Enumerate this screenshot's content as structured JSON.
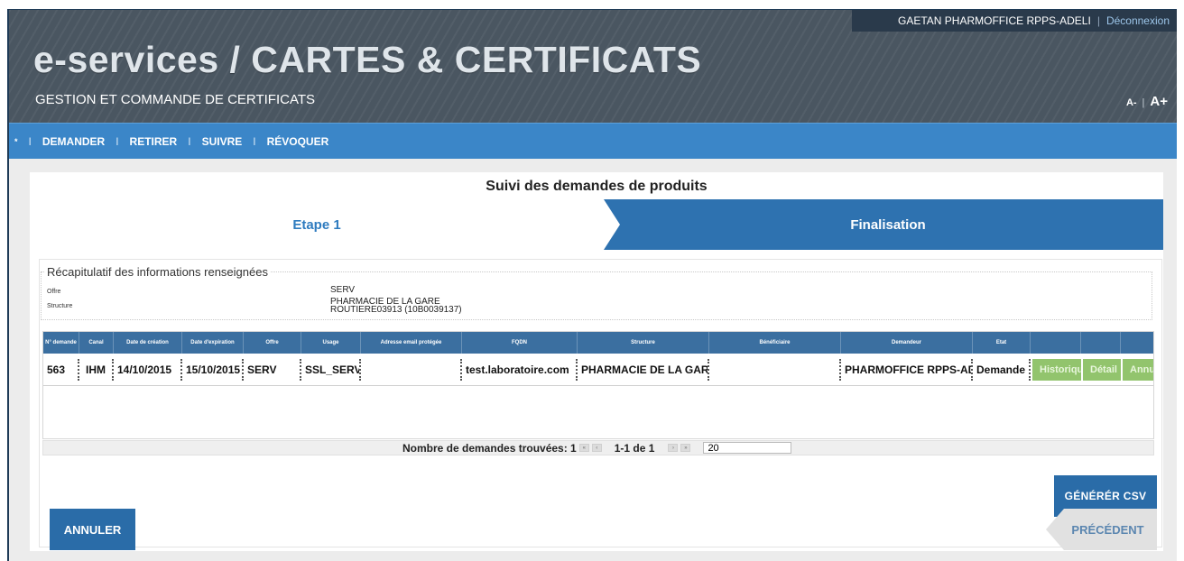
{
  "header": {
    "user": "GAETAN PHARMOFFICE RPPS-ADELI",
    "separator": "|",
    "logout_label": "Déconnexion",
    "title": "e-services / CARTES & CERTIFICATS",
    "subtitle": "GESTION ET COMMANDE DE CERTIFICATS",
    "font_small": "A-",
    "font_separator": "|",
    "font_large": "A+"
  },
  "nav": {
    "home_icon": "*",
    "separator": "I",
    "items": [
      "DEMANDER",
      "RETIRER",
      "SUIVRE",
      "RÉVOQUER"
    ]
  },
  "page": {
    "title": "Suivi des demandes de produits"
  },
  "steps": [
    {
      "label": "Etape 1"
    },
    {
      "label": "Finalisation"
    }
  ],
  "recap": {
    "legend": "Récapitulatif des informations renseignées",
    "offer_key": "Offre",
    "offer_value": "SERV",
    "structure_key": "Structure",
    "structure_line1": "PHARMACIE DE LA GARE",
    "structure_line2": "ROUTIERE03913 (10B0039137)"
  },
  "table": {
    "headers": [
      "N° demande",
      "Canal",
      "Date de création",
      "Date d'expiration",
      "Offre",
      "Usage",
      "Adresse email protégée",
      "FQDN",
      "Structure",
      "Bénéficiaire",
      "Demandeur",
      "Etat",
      "",
      "",
      ""
    ],
    "rows": [
      {
        "num": "563",
        "canal": "IHM",
        "creation": "14/10/2015",
        "expiration": "15/10/2015",
        "offre": "SERV",
        "usage": "SSL_SERV",
        "email": "",
        "fqdn": "test.laboratoire.com",
        "structure": "PHARMACIE DE LA GARE",
        "beneficiaire": "",
        "demandeur": "PHARMOFFICE RPPS-ADELI",
        "etat": "Demande",
        "btn_history": "Historique",
        "btn_detail": "Détail",
        "btn_cancel": "Annuler"
      }
    ]
  },
  "pager": {
    "label": "Nombre de demandes trouvées: 1",
    "range": "1-1 de 1",
    "page_size": "20"
  },
  "buttons": {
    "csv": "GÉNÉRÉR CSV",
    "cancel": "ANNULER",
    "previous": "PRÉCÉDENT"
  },
  "colors": {
    "header_bg": "#4a5661",
    "nav_bg": "#3b86c8",
    "accent_blue": "#2a6ca8",
    "table_header": "#3b6fa0",
    "action_green": "#92c46d"
  }
}
